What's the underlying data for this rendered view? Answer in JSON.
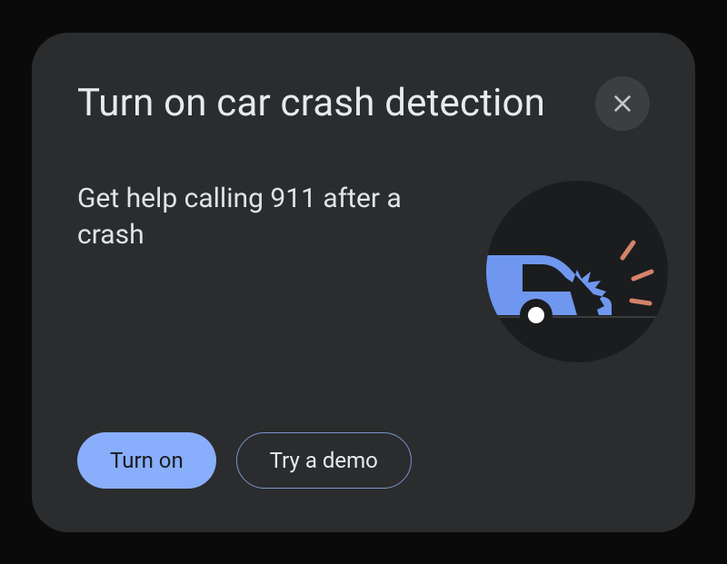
{
  "card": {
    "title": "Turn on car crash detection",
    "subtitle": "Get help calling 911 after a crash",
    "buttons": {
      "primary": "Turn on",
      "secondary": "Try a demo"
    }
  },
  "colors": {
    "accent": "#89aefb",
    "carBody": "#6f97ef",
    "impact": "#d4826a"
  }
}
